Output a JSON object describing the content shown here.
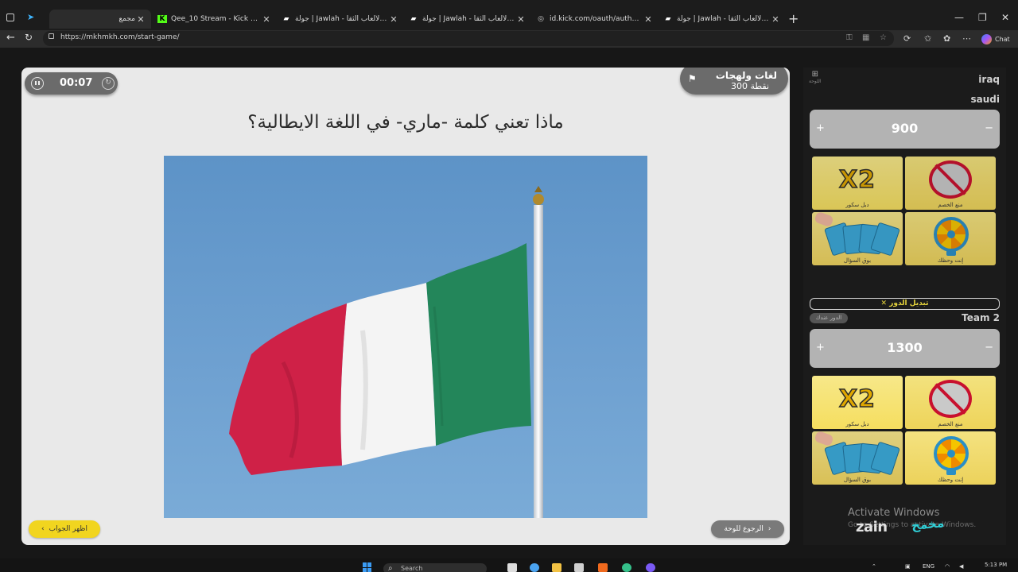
{
  "browser": {
    "tabs": [
      {
        "label": "مجمع",
        "active": true
      },
      {
        "label": "Qee_10 Stream - Kick Dashboard"
      },
      {
        "label": "جولة | Jawlah - منصة الألعاب الثقا..."
      },
      {
        "label": "جولة | Jawlah - منصة الألعاب الثقا..."
      },
      {
        "label": "id.kick.com/oauth/authorize?resp..."
      },
      {
        "label": "جولة | Jawlah - منصة الألعاب الثقا..."
      }
    ],
    "url": "https://mkhmkh.com/start-game/",
    "copilot_label": "Chat"
  },
  "game": {
    "timer": "00:07",
    "category": {
      "name": "لغات ولهجات",
      "points": "300 نقطة"
    },
    "question": "ماذا تعني كلمة -ماري- في اللغة الايطالية؟",
    "show_answer_label": "اظهر الجواب",
    "back_label": "الرجوع للوحة"
  },
  "sidebar": {
    "board_label": "اللوحة",
    "team1": {
      "name_top": "iraq",
      "name": "saudi",
      "score": "900",
      "cards": [
        {
          "icon": "x2-icon",
          "text": "X2",
          "label": "دبل سكور"
        },
        {
          "icon": "block-opponent-icon",
          "label": "منع الخصم"
        },
        {
          "icon": "swap-question-icon",
          "label": "بوق السؤال"
        },
        {
          "icon": "wheel-icon",
          "label": "إنت وحظك"
        }
      ]
    },
    "switch_turn_label": "تبديل الدور ✕",
    "turn_badge": "الدور عندك",
    "team2": {
      "name": "Team 2",
      "score": "1300",
      "cards": [
        {
          "icon": "x2-icon",
          "text": "X2",
          "label": "دبل سكور"
        },
        {
          "icon": "block-opponent-icon",
          "label": "منع الخصم"
        },
        {
          "icon": "swap-question-icon",
          "label": "بوق السؤال"
        },
        {
          "icon": "wheel-icon",
          "label": "إنت وحظك"
        }
      ]
    },
    "watermark_title": "Activate Windows",
    "watermark_sub": "Go to Settings to activate Windows.",
    "sponsor": "zain",
    "sponsor_ar": "مخمخ"
  },
  "taskbar": {
    "search_placeholder": "Search",
    "lang": "ENG",
    "time": "5:13 PM"
  },
  "colors": {
    "accent_yellow": "#f1d51f",
    "flag_green": "#23865a",
    "flag_white": "#f4f4f4",
    "flag_red": "#cf2147"
  }
}
